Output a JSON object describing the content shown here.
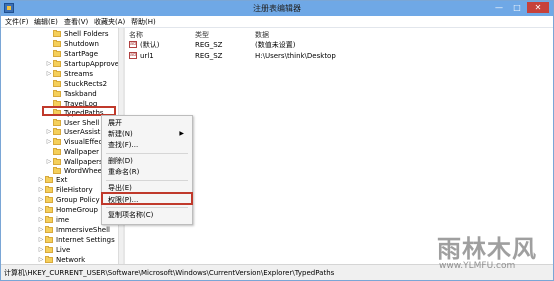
{
  "window": {
    "title": "注册表编辑器",
    "minimize": "—",
    "maximize": "□",
    "close": "✕"
  },
  "menubar": {
    "items": [
      "文件(F)",
      "编辑(E)",
      "查看(V)",
      "收藏夹(A)",
      "帮助(H)"
    ]
  },
  "tree": {
    "items": [
      {
        "label": "Shell Folders"
      },
      {
        "label": "Shutdown"
      },
      {
        "label": "StartPage"
      },
      {
        "label": "StartupApprove"
      },
      {
        "label": "Streams"
      },
      {
        "label": "StuckRects2"
      },
      {
        "label": "Taskband"
      },
      {
        "label": "TravelLog"
      },
      {
        "label": "TypedPaths"
      },
      {
        "label": "User Shell F"
      },
      {
        "label": "UserAssist"
      },
      {
        "label": "VisualEffects"
      },
      {
        "label": "Wallpaper"
      },
      {
        "label": "Wallpapers"
      },
      {
        "label": "WordWheel"
      },
      {
        "label": "Ext"
      },
      {
        "label": "FileHistory"
      },
      {
        "label": "Group Policy"
      },
      {
        "label": "HomeGroup"
      },
      {
        "label": "ime"
      },
      {
        "label": "ImmersiveShell"
      },
      {
        "label": "Internet Settings"
      },
      {
        "label": "Live"
      },
      {
        "label": "Network"
      }
    ]
  },
  "values": {
    "columns": [
      "名称",
      "类型",
      "数据"
    ],
    "rows": [
      {
        "name": "(默认)",
        "type": "REG_SZ",
        "data": "(数值未设置)"
      },
      {
        "name": "url1",
        "type": "REG_SZ",
        "data": "H:\\Users\\think\\Desktop"
      }
    ]
  },
  "context_menu": {
    "items": [
      {
        "label": "展开"
      },
      {
        "label": "新建(N)",
        "arrow": "▶"
      },
      {
        "label": "查找(F)..."
      },
      {
        "label": "删除(D)"
      },
      {
        "label": "重命名(R)"
      },
      {
        "label": "导出(E)"
      },
      {
        "label": "权限(P)..."
      },
      {
        "label": "复制项名称(C)"
      }
    ]
  },
  "statusbar": {
    "path": "计算机\\HKEY_CURRENT_USER\\Software\\Microsoft\\Windows\\CurrentVersion\\Explorer\\TypedPaths"
  },
  "watermark": {
    "brand": "雨林木风",
    "url": "www.YLMFU.com"
  }
}
